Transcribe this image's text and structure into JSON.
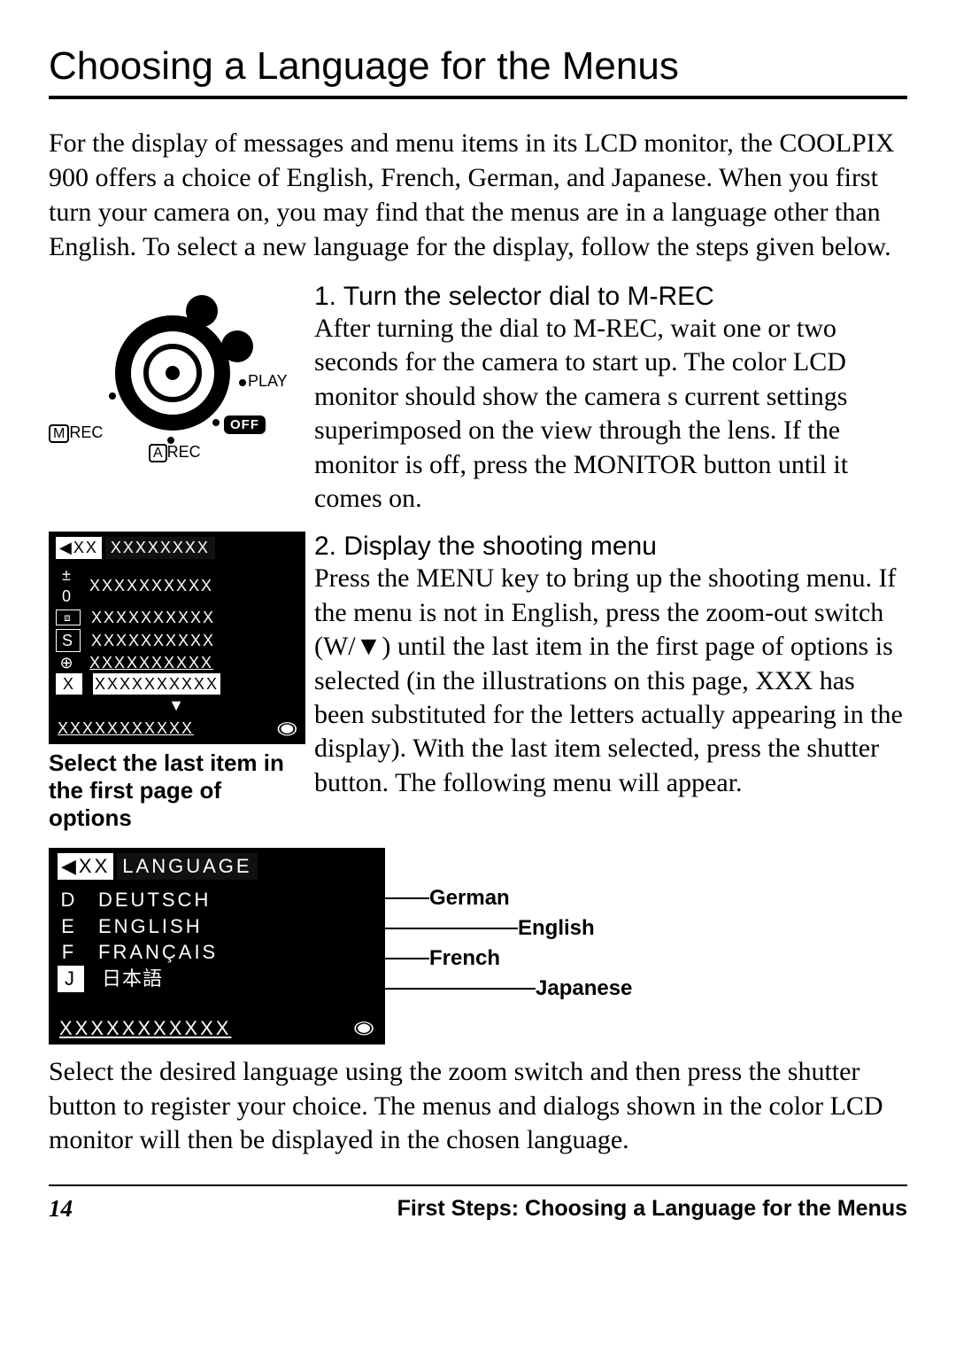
{
  "title": "Choosing a Language for the Menus",
  "intro": "For the display of messages and menu items in its LCD monitor, the COOLPIX 900 offers a choice of English, French, German, and Japanese.  When you first turn your camera on, you may find that the menus are in a language other than English.  To select a new language for the display, follow the steps given below.",
  "dial": {
    "play": "PLAY",
    "off": "OFF",
    "mrec_box": "M",
    "mrec_suffix": "REC",
    "arec_box": "A",
    "arec_suffix": "REC"
  },
  "step1_title": "1.  Turn the selector dial to M-REC",
  "step1_body": "After turning the dial to M-REC, wait one or two seconds for the camera to start up.  The color LCD monitor should show the camera s current settings superimposed on the view through the lens.  If the monitor is off, press the MONITOR button until it comes on.",
  "lcd1": {
    "tab_back": "◀XX",
    "tab_label": "XXXXXXXX",
    "icons": [
      "± 0",
      "⧈",
      "S",
      "⊕",
      "X"
    ],
    "row_text": "XXXXXXXXXX",
    "foot": "XXXXXXXXXXX"
  },
  "caption1": "Select the last item in the first page of options",
  "step2_title": "2.  Display the shooting menu",
  "step2_body": "Press the MENU key to bring up the shooting menu.  If the menu is not in English, press the zoom-out switch (W/▼) until the last item in the first page of options is selected (in the illustrations on this page,  XXX   has been substituted for the letters actually appearing in the display).  With the last item selected, press the shutter button.  The following menu will appear.",
  "lcd2": {
    "tab_back": "◀XX",
    "tab_label": "LANGUAGE",
    "letters": [
      "D",
      "E",
      "F",
      "J"
    ],
    "items": [
      "DEUTSCH",
      "ENGLISH",
      "FRANÇAIS",
      "日本語"
    ],
    "foot": "XXXXXXXXXXX"
  },
  "callouts": {
    "german": "German",
    "english": "English",
    "french": "French",
    "japanese": "Japanese"
  },
  "closing": "Select the desired language using the zoom switch and then press the shutter button to register your choice.  The menus and dialogs shown in the color LCD monitor will then be displayed in the chosen language.",
  "footer": {
    "page": "14",
    "section": "First Steps:  Choosing a Language for the Menus"
  }
}
